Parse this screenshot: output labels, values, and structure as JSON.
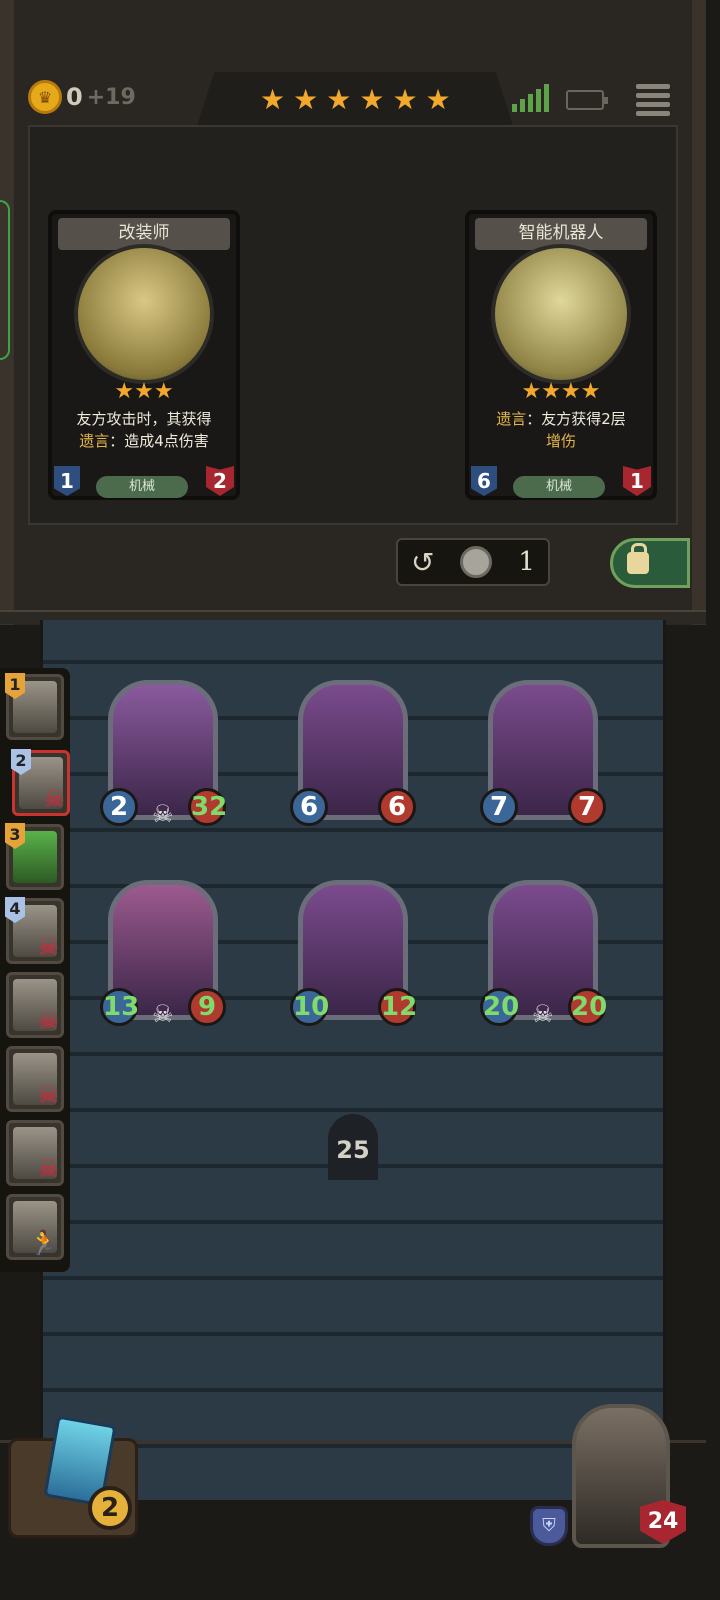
{
  "top": {
    "gold": "0",
    "gold_income": "+19",
    "tier_stars": 6,
    "star_glyph": "★"
  },
  "shop_cards": [
    {
      "name": "改装师",
      "stars": 3,
      "text_line1": "友方攻击时，其获得",
      "deathrattle_kw": "遗言",
      "text_line2": "：造成4点伤害",
      "tribe": "机械",
      "attack": "1",
      "health": "2"
    },
    {
      "name": "智能机器人",
      "stars": 4,
      "deathrattle_kw": "遗言",
      "text_line1": "：友方获得2层",
      "text_line2": "增伤",
      "tribe": "机械",
      "attack": "6",
      "health": "1"
    }
  ],
  "refresh": {
    "cost": "1"
  },
  "roster": [
    {
      "rank": "1",
      "rank_color": "#e6a33a",
      "status": ""
    },
    {
      "rank": "2",
      "rank_color": "#a9c2e6",
      "status": "dead",
      "selected": true
    },
    {
      "rank": "3",
      "rank_color": "#e6a33a",
      "status": ""
    },
    {
      "rank": "4",
      "rank_color": "#a9c2e6",
      "status": "dead"
    },
    {
      "rank": "",
      "status": "dead"
    },
    {
      "rank": "",
      "status": "dead"
    },
    {
      "rank": "",
      "status": "dead"
    },
    {
      "rank": "",
      "status": "fleeing"
    }
  ],
  "board": {
    "row1": [
      {
        "attack": "2",
        "health": "32",
        "buffed": true
      },
      {
        "attack": "6",
        "health": "6"
      },
      {
        "attack": "7",
        "health": "7"
      }
    ],
    "row2": [
      {
        "attack": "13",
        "health": "9",
        "buffed": true
      },
      {
        "attack": "10",
        "health": "12",
        "buffed": true
      },
      {
        "attack": "20",
        "health": "20",
        "buffed": true
      }
    ]
  },
  "graveyard_count": "25",
  "deck": {
    "count": "2"
  },
  "player": {
    "health": "24"
  }
}
